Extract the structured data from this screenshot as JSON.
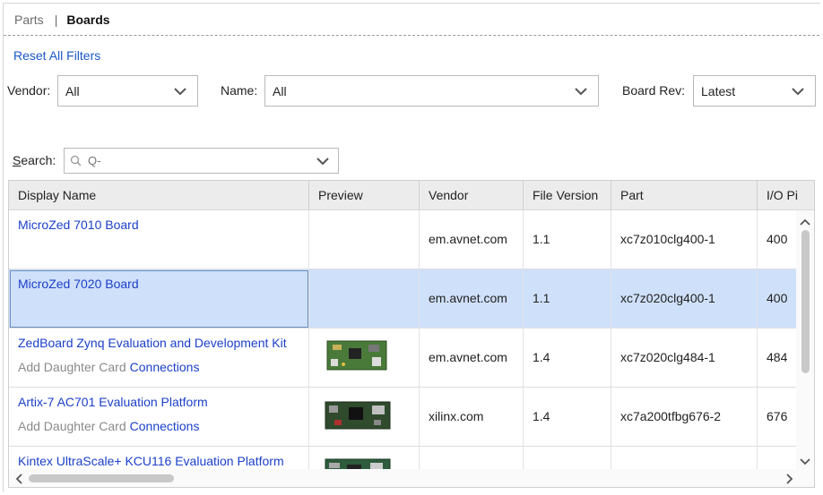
{
  "tabs": {
    "parts": "Parts",
    "separator": "|",
    "boards": "Boards"
  },
  "reset_filters": "Reset All Filters",
  "filters": {
    "vendor_label": "Vendor:",
    "vendor_value": "All",
    "name_label": "Name:",
    "name_value": "All",
    "rev_label": "Board Rev:",
    "rev_value": "Latest"
  },
  "search": {
    "label_first": "S",
    "label_rest": "earch:",
    "placeholder": "Q-"
  },
  "table": {
    "columns": {
      "display_name": "Display Name",
      "preview": "Preview",
      "vendor": "Vendor",
      "file_version": "File Version",
      "part": "Part",
      "io_pins": "I/O Pi"
    },
    "daughter_card": "Add Daughter Card",
    "connections": "Connections",
    "rows": [
      {
        "name": "MicroZed 7010 Board",
        "vendor": "em.avnet.com",
        "version": "1.1",
        "part": "xc7z010clg400-1",
        "io": "400"
      },
      {
        "name": "MicroZed 7020 Board",
        "vendor": "em.avnet.com",
        "version": "1.1",
        "part": "xc7z020clg400-1",
        "io": "400"
      },
      {
        "name": "ZedBoard Zynq Evaluation and Development Kit",
        "vendor": "em.avnet.com",
        "version": "1.4",
        "part": "xc7z020clg484-1",
        "io": "484"
      },
      {
        "name": "Artix-7 AC701 Evaluation Platform",
        "vendor": "xilinx.com",
        "version": "1.4",
        "part": "xc7a200tfbg676-2",
        "io": "676"
      },
      {
        "name": "Kintex UltraScale+ KCU116 Evaluation Platform",
        "vendor": "",
        "version": "",
        "part": "",
        "io": ""
      }
    ]
  },
  "colors": {
    "link": "#1b3fc9",
    "selection": "#cfe0fa",
    "header_bg": "#ececec"
  }
}
